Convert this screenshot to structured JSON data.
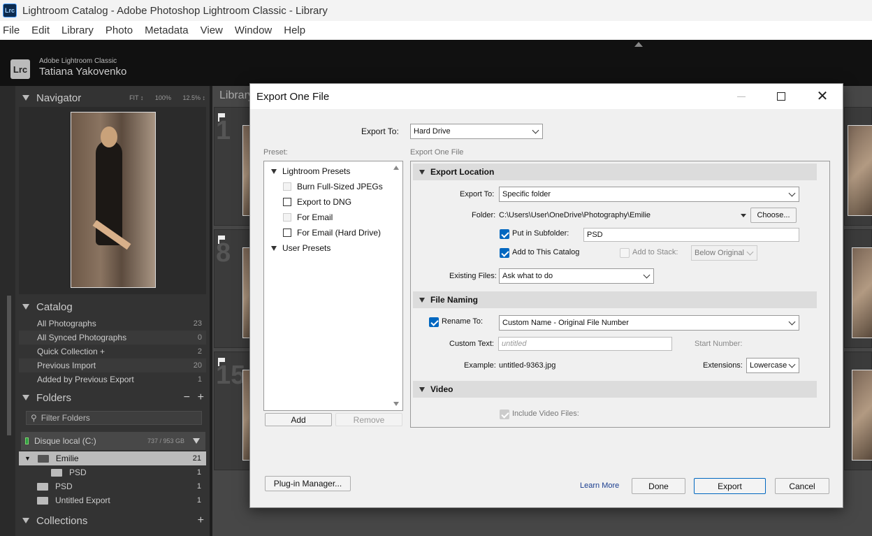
{
  "window": {
    "app_icon": "Lrc",
    "title": "Lightroom Catalog - Adobe Photoshop Lightroom Classic - Library"
  },
  "menu": [
    "File",
    "Edit",
    "Library",
    "Photo",
    "Metadata",
    "View",
    "Window",
    "Help"
  ],
  "identity": {
    "logo": "Lrc",
    "product": "Adobe Lightroom Classic",
    "user": "Tatiana Yakovenko"
  },
  "navigator": {
    "title": "Navigator",
    "options": [
      "FIT ↕",
      "100%",
      "12.5% ↕"
    ]
  },
  "catalog": {
    "title": "Catalog",
    "items": [
      {
        "label": "All Photographs",
        "count": "23"
      },
      {
        "label": "All Synced Photographs",
        "count": "0"
      },
      {
        "label": "Quick Collection +",
        "count": "2"
      },
      {
        "label": "Previous Import",
        "count": "20"
      },
      {
        "label": "Added by Previous Export",
        "count": "1"
      }
    ]
  },
  "folders": {
    "title": "Folders",
    "actions": [
      "−",
      "+"
    ],
    "filter": "Filter Folders",
    "disk": {
      "name": "Disque local (C:)",
      "size": "737 / 953 GB"
    },
    "items": [
      {
        "label": "Emilie",
        "count": "21"
      },
      {
        "label": "PSD",
        "count": "1"
      },
      {
        "label": "PSD",
        "count": "1"
      },
      {
        "label": "Untitled Export",
        "count": "1"
      }
    ]
  },
  "collections": {
    "title": "Collections",
    "action": "+"
  },
  "grid": {
    "header": "Library",
    "cell_numbers": [
      "1",
      "8",
      "15"
    ]
  },
  "dialog": {
    "title": "Export One File",
    "export_to_label": "Export To:",
    "export_to_value": "Hard Drive",
    "preset_label": "Preset:",
    "settings_label": "Export One File",
    "presets": {
      "lightroom_group": "Lightroom Presets",
      "items": [
        "Burn Full-Sized JPEGs",
        "Export to DNG",
        "For Email",
        "For Email (Hard Drive)"
      ],
      "user_group": "User Presets"
    },
    "add_button": "Add",
    "remove_button": "Remove",
    "export_location": {
      "header": "Export Location",
      "export_to_label": "Export To:",
      "export_to_value": "Specific folder",
      "folder_label": "Folder:",
      "folder_path": "C:\\Users\\User\\OneDrive\\Photography\\Emilie",
      "choose_button": "Choose...",
      "subfolder_label": "Put in Subfolder:",
      "subfolder_value": "PSD",
      "add_catalog_label": "Add to This Catalog",
      "add_stack_label": "Add to Stack:",
      "stack_value": "Below Original",
      "existing_label": "Existing Files:",
      "existing_value": "Ask what to do"
    },
    "file_naming": {
      "header": "File Naming",
      "rename_label": "Rename To:",
      "rename_value": "Custom Name - Original File Number",
      "custom_text_label": "Custom Text:",
      "custom_text_placeholder": "untitled",
      "start_number_label": "Start Number:",
      "example_label": "Example:",
      "example_value": "untitled-9363.jpg",
      "extensions_label": "Extensions:",
      "extensions_value": "Lowercase"
    },
    "video": {
      "header": "Video",
      "include_label": "Include Video Files:"
    },
    "plugin_button": "Plug-in Manager...",
    "learn_more": "Learn More",
    "done_button": "Done",
    "export_button": "Export",
    "cancel_button": "Cancel"
  }
}
